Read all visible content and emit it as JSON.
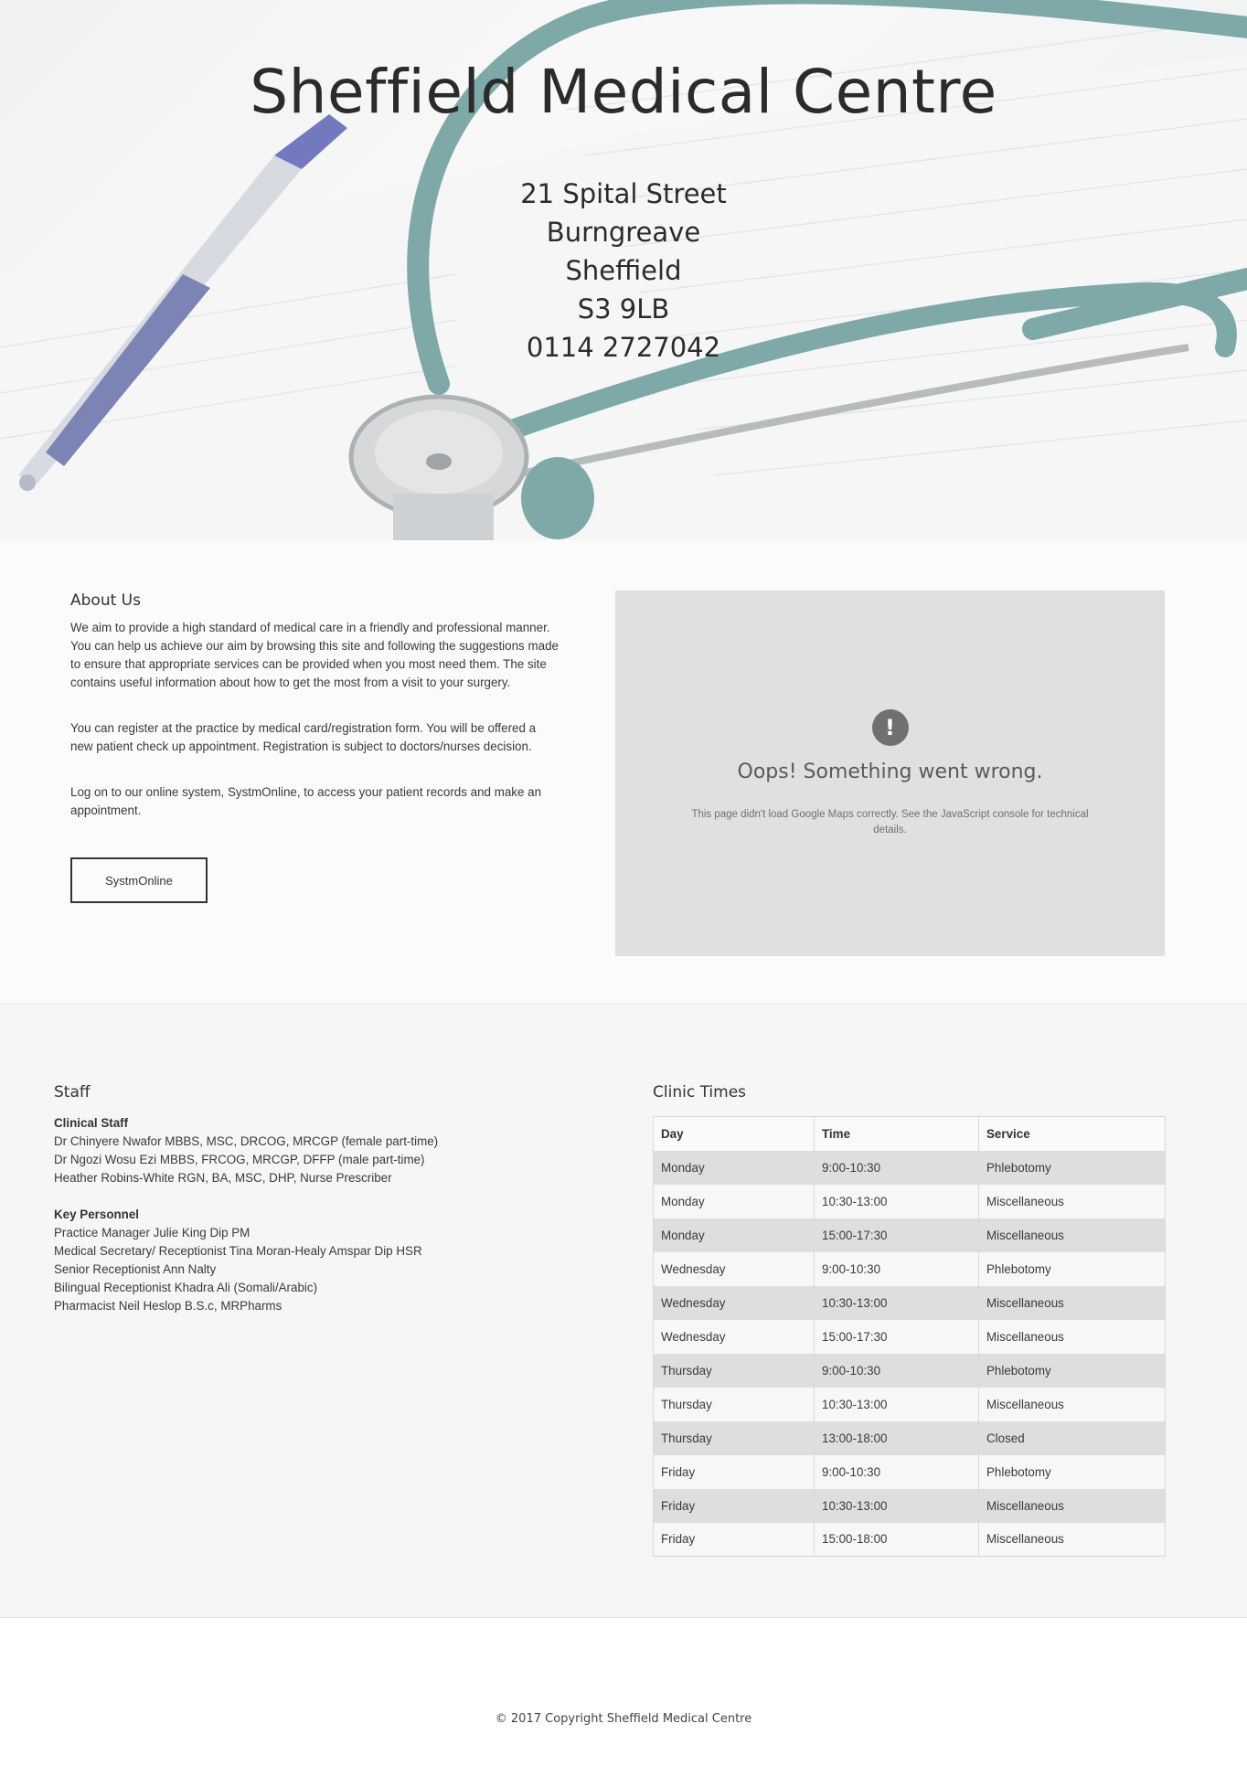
{
  "hero": {
    "title": "Sheffield Medical Centre",
    "address": [
      "21 Spital Street",
      "Burngreave",
      "Sheffield",
      "S3 9LB",
      "0114 2727042"
    ]
  },
  "about": {
    "heading": "About Us",
    "paragraphs": [
      "We aim to provide a high standard of medical care in a friendly and professional manner. You can help us achieve our aim by browsing this site and following the suggestions made to ensure that appropriate services can be provided when you most need them. The site contains useful information about how to get the most from a visit to your surgery.",
      "You can register at the practice by medical card/registration form. You will be offered a new patient check up appointment. Registration is subject to doctors/nurses decision.",
      "Log on to our online system, SystmOnline, to access your patient records and make an appointment."
    ],
    "button_label": "SystmOnline"
  },
  "map": {
    "icon": "alert-icon",
    "icon_glyph": "!",
    "title": "Oops! Something went wrong.",
    "message": "This page didn't load Google Maps correctly. See the JavaScript console for technical details."
  },
  "staff": {
    "heading": "Staff",
    "clinical_heading": "Clinical Staff",
    "clinical": [
      "Dr Chinyere Nwafor MBBS, MSC, DRCOG, MRCGP (female part-time)",
      "Dr Ngozi Wosu Ezi MBBS, FRCOG, MRCGP, DFFP (male part-time)",
      "Heather Robins-White RGN, BA, MSC, DHP, Nurse Prescriber"
    ],
    "key_heading": "Key Personnel",
    "key": [
      "Practice Manager Julie King Dip PM",
      "Medical Secretary/ Receptionist Tina Moran-Healy Amspar Dip HSR",
      "Senior Receptionist Ann Nalty",
      "Bilingual Receptionist Khadra Ali (Somali/Arabic)",
      "Pharmacist Neil Heslop B.S.c, MRPharms"
    ]
  },
  "clinic": {
    "heading": "Clinic Times",
    "columns": [
      "Day",
      "Time",
      "Service"
    ],
    "rows": [
      [
        "Monday",
        "9:00-10:30",
        "Phlebotomy"
      ],
      [
        "Monday",
        "10:30-13:00",
        "Miscellaneous"
      ],
      [
        "Monday",
        "15:00-17:30",
        "Miscellaneous"
      ],
      [
        "Wednesday",
        "9:00-10:30",
        "Phlebotomy"
      ],
      [
        "Wednesday",
        "10:30-13:00",
        "Miscellaneous"
      ],
      [
        "Wednesday",
        "15:00-17:30",
        "Miscellaneous"
      ],
      [
        "Thursday",
        "9:00-10:30",
        "Phlebotomy"
      ],
      [
        "Thursday",
        "10:30-13:00",
        "Miscellaneous"
      ],
      [
        "Thursday",
        "13:00-18:00",
        "Closed"
      ],
      [
        "Friday",
        "9:00-10:30",
        "Phlebotomy"
      ],
      [
        "Friday",
        "10:30-13:00",
        "Miscellaneous"
      ],
      [
        "Friday",
        "15:00-18:00",
        "Miscellaneous"
      ]
    ]
  },
  "footer": {
    "copyright": "© 2017 Copyright Sheffield Medical Centre"
  }
}
